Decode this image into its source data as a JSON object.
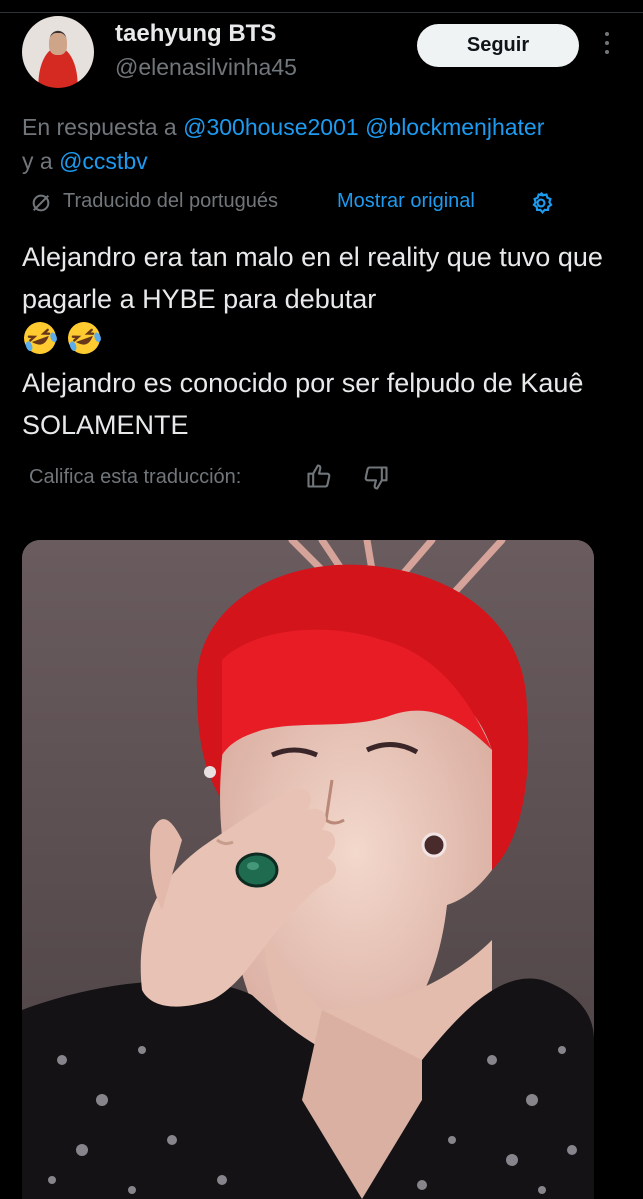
{
  "author": {
    "display_name": "taehyung BTS",
    "handle": "@elenasilvinha45",
    "follow_label": "Seguir"
  },
  "reply": {
    "prefix": "En respuesta a ",
    "mention_1": "@300house2001",
    "mention_2": "@blockmenjhater",
    "and": "y a ",
    "mention_3": "@ccstbv"
  },
  "translation": {
    "label": "Traducido del portugués",
    "show_original": "Mostrar original"
  },
  "tweet": {
    "line_1": "Alejandro era tan malo en el reality que tuvo que pagarle a HYBE para debutar",
    "emoji_name": "rolling-on-floor-laughing",
    "line_2": "Alejandro es conocido por ser felpudo de Kauê SOLAMENTE"
  },
  "rating": {
    "label": "Califica esta traducción:"
  },
  "colors": {
    "background": "#000000",
    "primary_text": "#e7e9ea",
    "secondary_text": "#71767b",
    "link": "#1d9bf0",
    "follow_button_bg": "#eff3f4"
  },
  "icons": [
    "more-vertical-icon",
    "translate-icon",
    "gear-icon",
    "thumbs-up-icon",
    "thumbs-down-icon"
  ]
}
